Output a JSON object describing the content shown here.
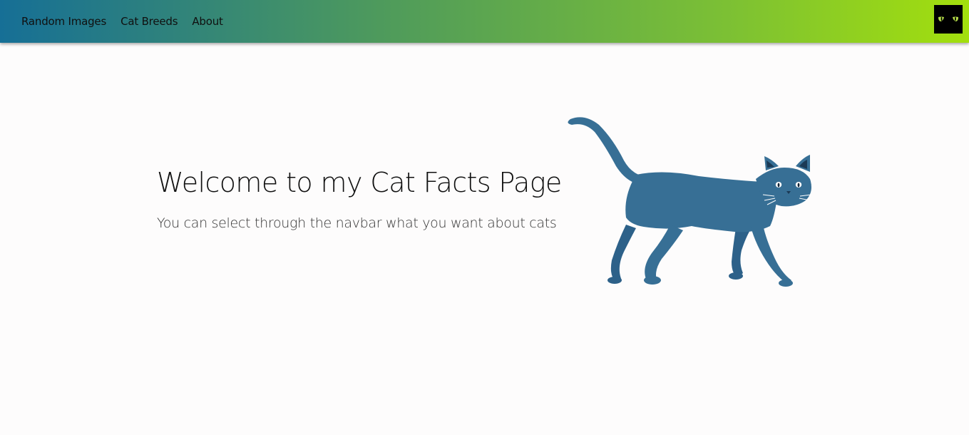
{
  "navbar": {
    "links": [
      {
        "label": "Random Images"
      },
      {
        "label": "Cat Breeds"
      },
      {
        "label": "About"
      }
    ],
    "logo_icon": "cat-eyes-icon",
    "gradient_colors": [
      "#166f96",
      "#4f9b5b",
      "#7cc034",
      "#a3df0d"
    ]
  },
  "hero": {
    "title": "Welcome to my Cat Facts Page",
    "subtitle": "You can select through the navbar what you want about cats",
    "illustration_icon": "walking-cat-illustration",
    "cat_color": "#376f95"
  }
}
